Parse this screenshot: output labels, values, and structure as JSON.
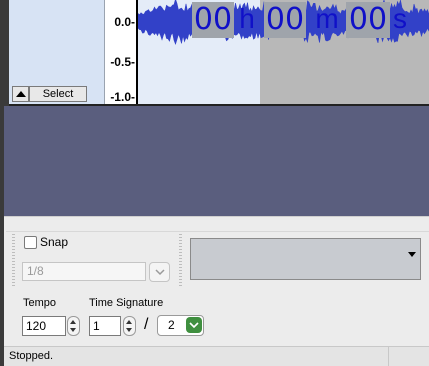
{
  "track": {
    "select_label": "Select",
    "ruler_labels": [
      "0.0-",
      "-0.5-",
      "-1.0-"
    ]
  },
  "snap": {
    "label": "Snap",
    "checked": false,
    "value": "1/8"
  },
  "time_display": {
    "hours": "00",
    "hours_unit": "h",
    "minutes": "00",
    "minutes_unit": "m",
    "seconds": "00",
    "seconds_unit": "s"
  },
  "tempo": {
    "label": "Tempo",
    "value": "120"
  },
  "time_signature": {
    "label": "Time Signature",
    "numerator": "1",
    "separator": "/",
    "denominator": "2"
  },
  "status": {
    "text": "Stopped."
  },
  "colors": {
    "waveform": "#3241c8",
    "time_digits": "#1010c8",
    "track_background": "#5a5e7e"
  }
}
